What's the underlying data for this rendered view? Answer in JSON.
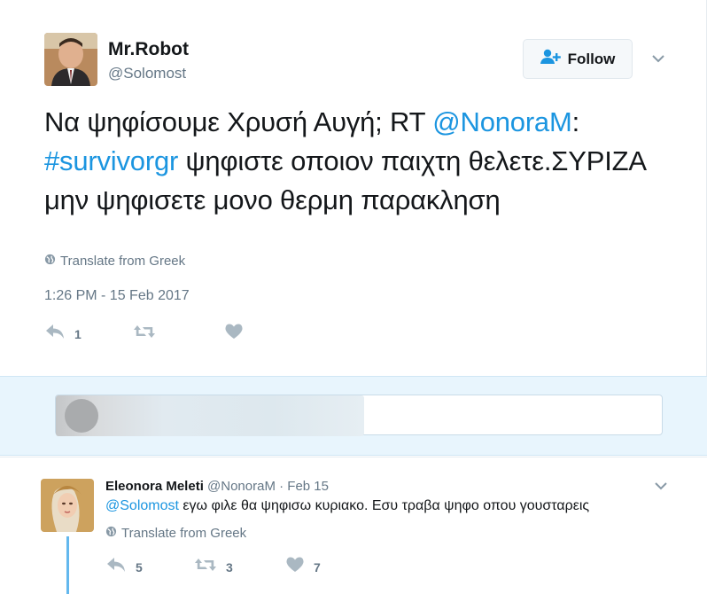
{
  "tweet": {
    "author": {
      "name": "Mr.Robot",
      "handle": "@Solomost"
    },
    "follow_label": "Follow",
    "text_parts": {
      "t1": "Να ψηφίσουμε Χρυσή Αυγή; RT ",
      "mention": "@NonoraM",
      "t2": ":",
      "hashtag": "#survivorgr",
      "t3": " ψηφιστε οποιον παιχτη θελετε.ΣΥΡΙΖΑ μην ψηφισετε μονο θερμη παρακληση"
    },
    "translate_label": "Translate from Greek",
    "timestamp": "1:26 PM - 15 Feb 2017",
    "actions": {
      "reply_count": "1",
      "retweet_count": "",
      "like_count": ""
    }
  },
  "reply_box": {
    "value": ""
  },
  "reply": {
    "author": {
      "name": "Eleonora Meleti",
      "handle": "@NonoraM",
      "date": "· Feb 15"
    },
    "mention": "@Solomost",
    "text": " εγω φιλε θα ψηφισω κυριακο. Εσυ τραβα ψηφο οπου γουσταρεις",
    "translate_label": "Translate from Greek",
    "actions": {
      "reply_count": "5",
      "retweet_count": "3",
      "like_count": "7"
    }
  },
  "colors": {
    "link": "#1b95e0",
    "muted": "#657786",
    "thread": "#63b8ee",
    "reply_bg": "#e8f5fd"
  },
  "icons": [
    "globe-icon",
    "reply-icon",
    "retweet-icon",
    "heart-icon",
    "chevron-down-icon",
    "follow-person-icon"
  ]
}
